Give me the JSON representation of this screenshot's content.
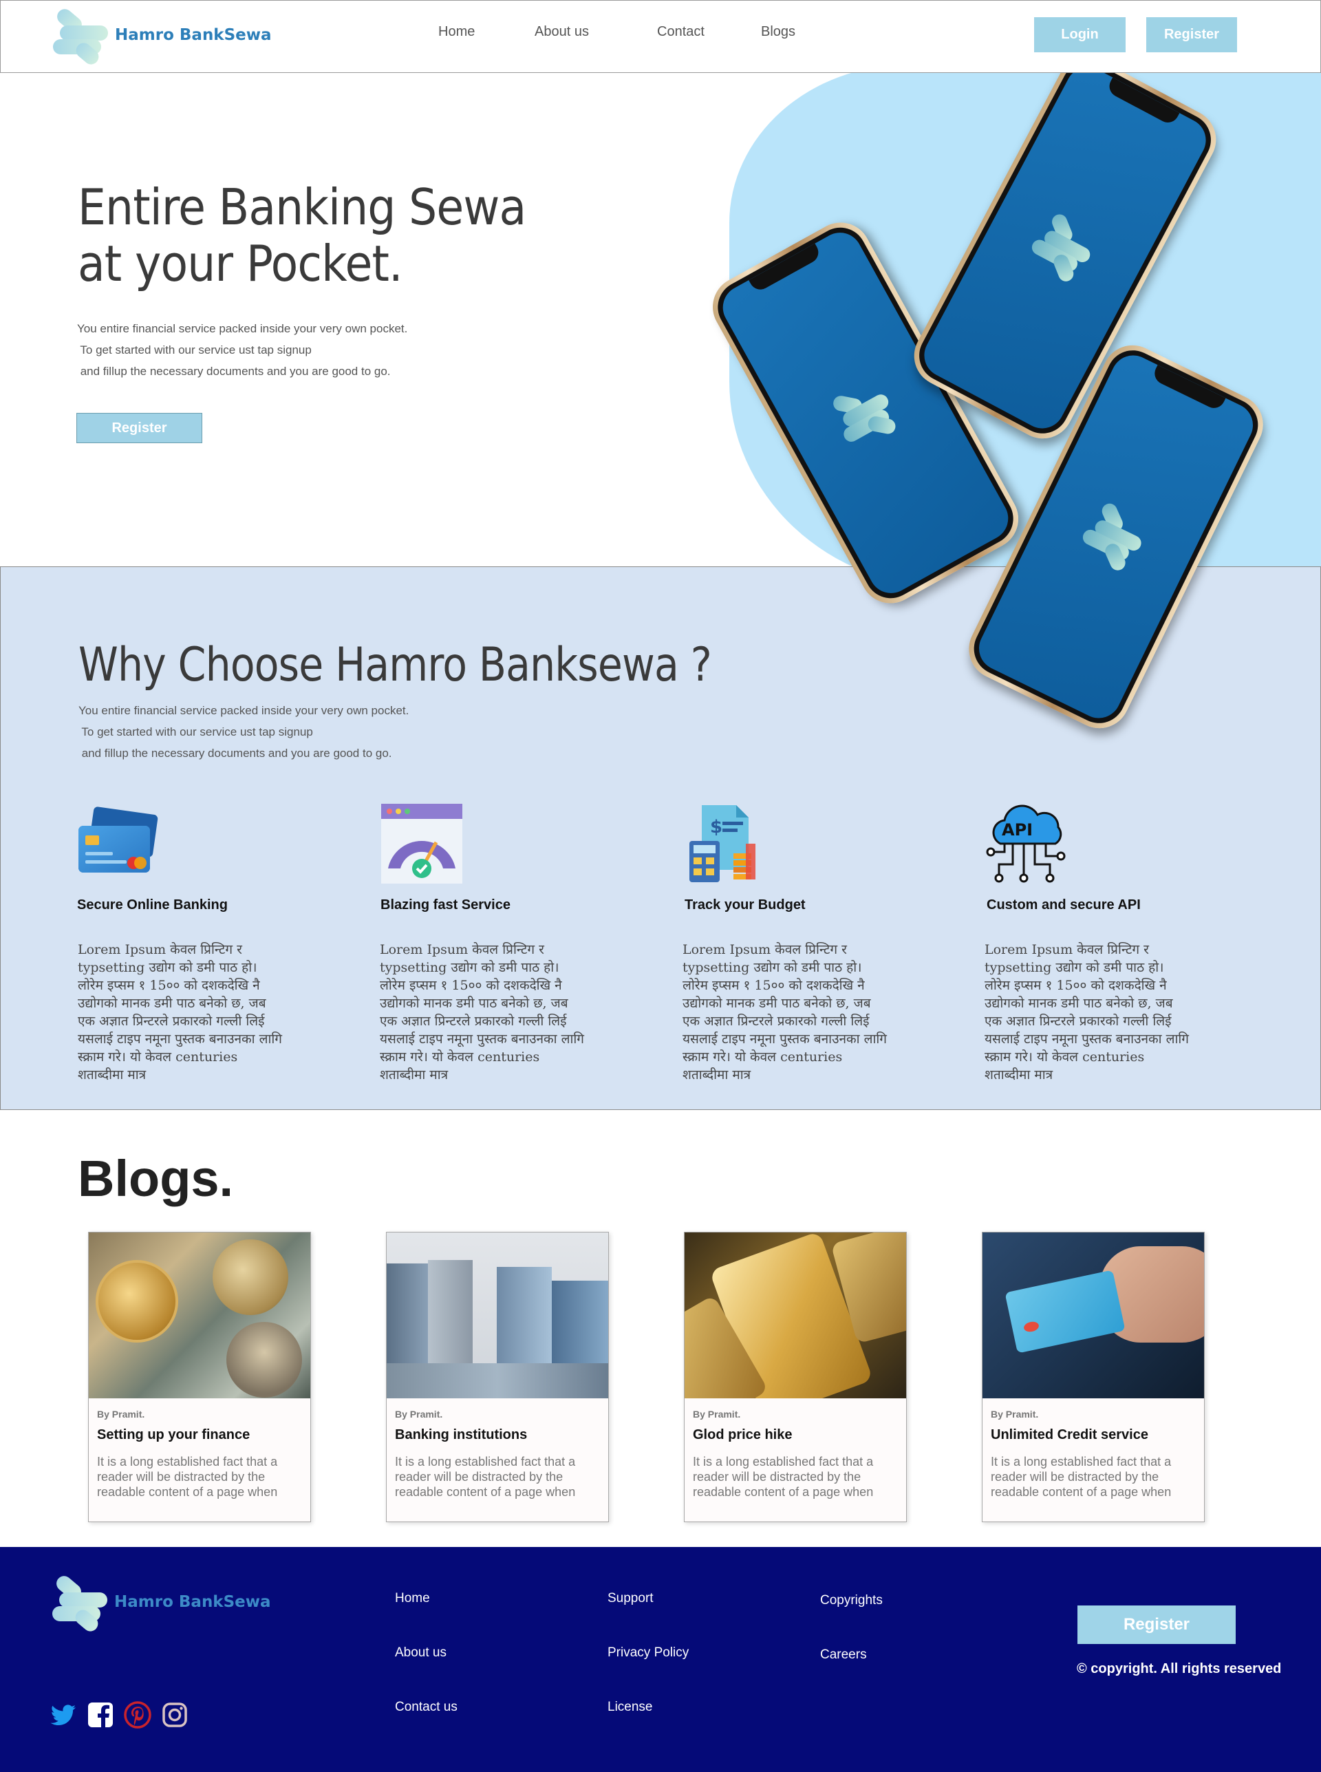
{
  "brand": {
    "name": "Hamro BankSewa"
  },
  "nav": {
    "home": "Home",
    "about": "About us",
    "contact": "Contact",
    "blogs": "Blogs"
  },
  "header": {
    "login": "Login",
    "register": "Register"
  },
  "hero": {
    "title_line1": "Entire Banking Sewa",
    "title_line2": "at your Pocket.",
    "desc": "You entire financial service packed inside your very own pocket.\n To get started with our service ust tap signup\n and fillup the necessary documents and you are good to go.",
    "register": "Register"
  },
  "why": {
    "title": "Why Choose Hamro Banksewa ?",
    "desc": "You entire financial service packed inside your very own pocket.\n To get started with our service ust tap signup\n and fillup the necessary documents and you are good to go.",
    "features": [
      {
        "title": "Secure Online Banking",
        "icon": "credit-card-icon",
        "body": "Lorem Ipsum केवल प्रिन्टिग र typsetting उद्योग को डमी पाठ हो। लोरेम इप्सम १ 15०० को दशकदेखि नै उद्योगको मानक डमी पाठ बनेको छ, जब एक अज्ञात प्रिन्टरले प्रकारको गल्ली लिई यसलाई टाइप नमूना पुस्तक बनाउनका लागि स्क्राम गरे। यो केवल centuries शताब्दीमा मात्र"
      },
      {
        "title": "Blazing fast Service",
        "icon": "speed-gauge-icon",
        "body": "Lorem Ipsum केवल प्रिन्टिग र typsetting उद्योग को डमी पाठ हो। लोरेम इप्सम १ 15०० को दशकदेखि नै उद्योगको मानक डमी पाठ बनेको छ, जब एक अज्ञात प्रिन्टरले प्रकारको गल्ली लिई यसलाई टाइप नमूना पुस्तक बनाउनका लागि स्क्राम गरे। यो केवल centuries शताब्दीमा मात्र"
      },
      {
        "title": "Track your Budget",
        "icon": "budget-calculator-icon",
        "body": "Lorem Ipsum केवल प्रिन्टिग र typsetting उद्योग को डमी पाठ हो। लोरेम इप्सम १ 15०० को दशकदेखि नै उद्योगको मानक डमी पाठ बनेको छ, जब एक अज्ञात प्रिन्टरले प्रकारको गल्ली लिई यसलाई टाइप नमूना पुस्तक बनाउनका लागि स्क्राम गरे। यो केवल centuries शताब्दीमा मात्र"
      },
      {
        "title": "Custom and secure API",
        "icon": "cloud-api-icon",
        "api_label": "API",
        "body": "Lorem Ipsum केवल प्रिन्टिग र typsetting उद्योग को डमी पाठ हो। लोरेम इप्सम १ 15०० को दशकदेखि नै उद्योगको मानक डमी पाठ बनेको छ, जब एक अज्ञात प्रिन्टरले प्रकारको गल्ली लिई यसलाई टाइप नमूना पुस्तक बनाउनका लागि स्क्राम गरे। यो केवल centuries शताब्दीमा मात्र"
      }
    ]
  },
  "blogs": {
    "title": "Blogs.",
    "cards": [
      {
        "by": "By Pramit.",
        "title": "Setting up your finance",
        "body": "It is a long established fact that a reader will be distracted by the readable content of a page when",
        "image": "bitcoin-dollar-photo"
      },
      {
        "by": "By Pramit.",
        "title": "Banking institutions",
        "body": "It is a long established fact that a reader will be distracted by the readable content of a page when",
        "image": "bank-buildings-photo"
      },
      {
        "by": "By Pramit.",
        "title": "Glod price hike",
        "body": "It is a long established fact that a reader will be distracted by the readable content of a page when",
        "image": "gold-bars-photo"
      },
      {
        "by": "By Pramit.",
        "title": "Unlimited Credit service",
        "body": "It is a long established fact that a reader will be distracted by the readable content of a page when",
        "image": "credit-card-hand-photo"
      }
    ]
  },
  "footer": {
    "col1": [
      "Home",
      "About us",
      "Contact us"
    ],
    "col2": [
      "Support",
      "Privacy Policy",
      "License"
    ],
    "col3": [
      "Copyrights",
      "Careers"
    ],
    "register": "Register",
    "copyright": "© copyright. All rights reserved",
    "social": [
      "twitter-icon",
      "facebook-icon",
      "pinterest-icon",
      "instagram-icon"
    ]
  },
  "colors": {
    "accent": "#9ed3e6",
    "hero_blob": "#b9e4fa",
    "why_bg": "#d6e3f3",
    "footer_bg": "#050a78",
    "brand_text": "#2d7fb9"
  }
}
